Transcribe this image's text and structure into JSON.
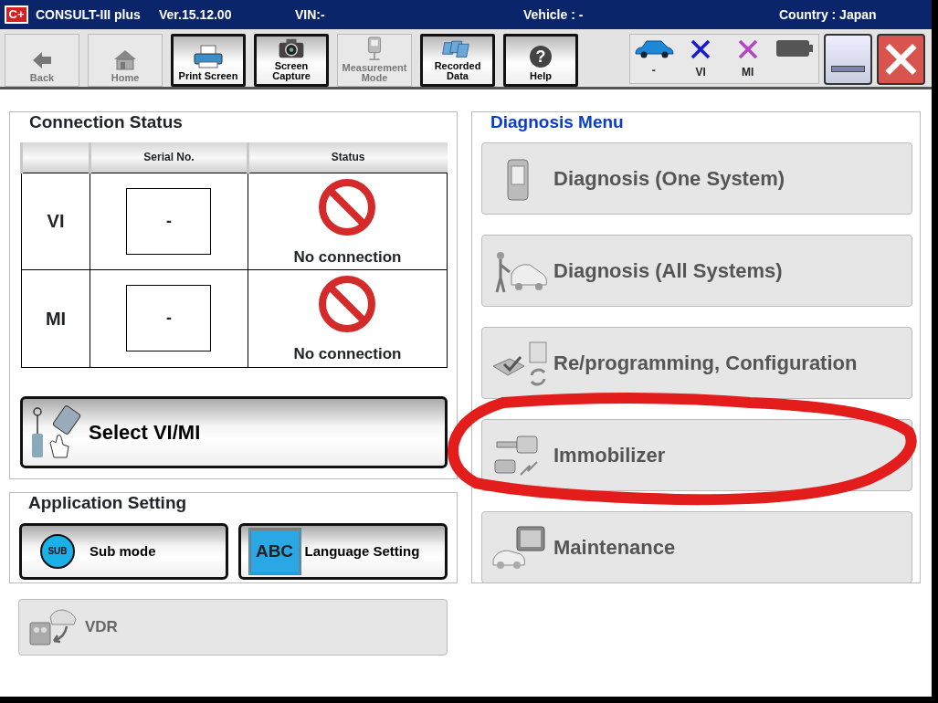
{
  "window": {
    "logo": "C+",
    "app": "CONSULT-III plus",
    "version": "Ver.15.12.00",
    "vin": "VIN:-",
    "vehicle": "Vehicle : -",
    "country": "Country : Japan"
  },
  "toolbar": [
    {
      "label": "Back",
      "kind": "back",
      "disabled": true
    },
    {
      "label": "Home",
      "kind": "home",
      "disabled": true
    },
    {
      "label": "Print Screen",
      "kind": "print",
      "disabled": false
    },
    {
      "label": "Screen Capture",
      "kind": "camera",
      "disabled": false
    },
    {
      "label": "Measurement Mode",
      "kind": "measure",
      "disabled": true
    },
    {
      "label": "Recorded Data",
      "kind": "folders",
      "disabled": false
    },
    {
      "label": "Help",
      "kind": "help",
      "icon_text": "?",
      "disabled": false
    }
  ],
  "status_indicators": [
    {
      "label": "-",
      "kind": "car"
    },
    {
      "label": "VI",
      "kind": "cross",
      "color": "#1a1ad0"
    },
    {
      "label": "MI",
      "kind": "cross",
      "color": "#b445c4"
    },
    {
      "kind": "battery"
    }
  ],
  "connection_status": {
    "title": "Connection Status",
    "columns": [
      "Serial No.",
      "Status"
    ],
    "rows": [
      {
        "device": "VI",
        "serial": "-",
        "status": "No connection",
        "connected": false
      },
      {
        "device": "MI",
        "serial": "-",
        "status": "No connection",
        "connected": false
      }
    ]
  },
  "select_button": {
    "label": "Select VI/MI"
  },
  "application_setting": {
    "title": "Application Setting",
    "buttons": [
      {
        "label": "Sub mode",
        "kind": "sub",
        "icon_text": "SUB"
      },
      {
        "label": "Language Setting",
        "kind": "abc",
        "icon_text": "ABC"
      }
    ]
  },
  "vdr": {
    "label": "VDR",
    "disabled": true
  },
  "diagnosis_menu": {
    "title": "Diagnosis Menu",
    "items": [
      {
        "label": "Diagnosis (One System)",
        "kind": "one-system",
        "disabled": true,
        "circled": false
      },
      {
        "label": "Diagnosis (All Systems)",
        "kind": "all-systems",
        "disabled": true,
        "circled": false
      },
      {
        "label": "Re/programming, Configuration",
        "kind": "reprogramming",
        "disabled": true,
        "circled": false
      },
      {
        "label": "Immobilizer",
        "kind": "immobilizer",
        "disabled": true,
        "circled": true
      },
      {
        "label": "Maintenance",
        "kind": "maintenance",
        "disabled": true,
        "circled": false
      }
    ]
  }
}
